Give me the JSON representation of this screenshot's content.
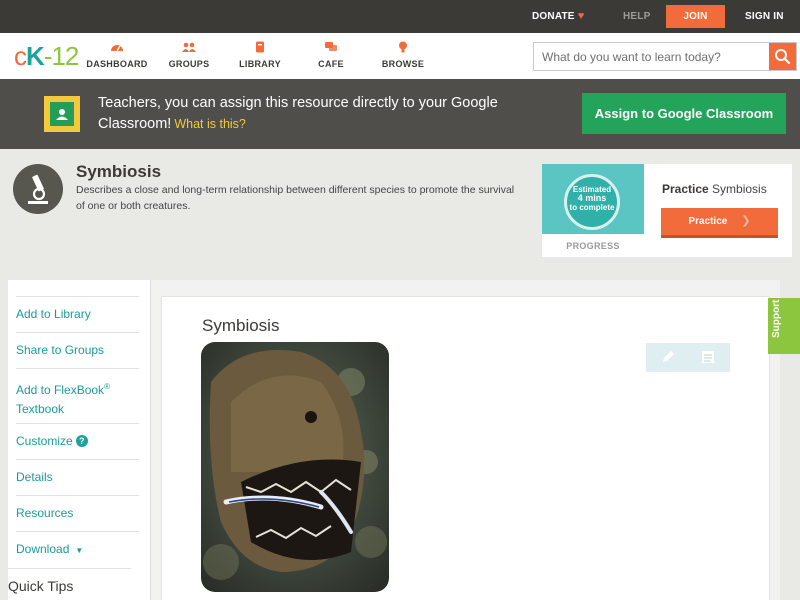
{
  "topbar": {
    "donate": "DONATE",
    "help": "HELP",
    "join": "JOIN",
    "signin": "SIGN IN"
  },
  "logo": {
    "c": "c",
    "k": "K",
    "dash": "-",
    "num": "12"
  },
  "nav": {
    "dashboard": "DASHBOARD",
    "groups": "GROUPS",
    "library": "LIBRARY",
    "cafe": "CAFE",
    "browse": "BROWSE"
  },
  "search": {
    "placeholder": "What do you want to learn today?"
  },
  "banner": {
    "text": "Teachers, you can assign this resource directly to your Google Classroom!",
    "whatis": "What is this?",
    "assign": "Assign to Google Classroom"
  },
  "concept": {
    "title": "Symbiosis",
    "description": "Describes a close and long-term relationship between different species to promote the survival of one or both creatures."
  },
  "practice": {
    "estimated": "Estimated",
    "mins": "4 mins",
    "to_complete": "to complete",
    "progress_label": "PROGRESS",
    "title_bold": "Practice",
    "title_rest": "Symbiosis",
    "button": "Practice"
  },
  "sidebar": {
    "add_library": "Add to Library",
    "share_groups": "Share to Groups",
    "add_flexbook": "Add to FlexBook",
    "reg": "®",
    "textbook": "Textbook",
    "customize": "Customize",
    "help_q": "?",
    "details": "Details",
    "resources": "Resources",
    "download": "Download",
    "quick_tips": "Quick Tips"
  },
  "main": {
    "title": "Symbiosis"
  },
  "support": "Support",
  "colors": {
    "brand_orange": "#f26b3a",
    "brand_teal": "#1ba39c",
    "brand_green": "#8cc63e",
    "classroom_green": "#23a45a"
  },
  "icons": [
    "heart-icon",
    "dashboard-icon",
    "groups-icon",
    "library-icon",
    "cafe-icon",
    "browse-icon",
    "search-icon",
    "google-classroom-icon",
    "microscope-icon",
    "pencil-icon",
    "notes-icon"
  ]
}
